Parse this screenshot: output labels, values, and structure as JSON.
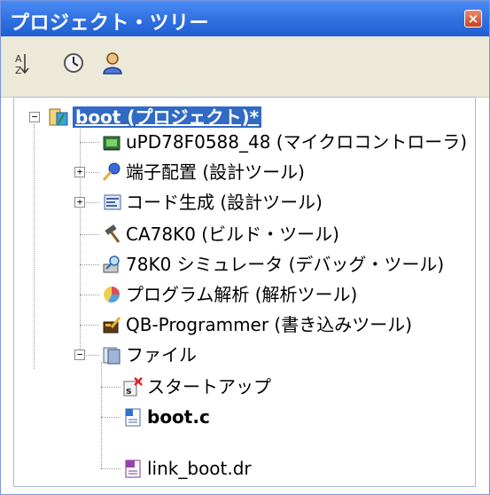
{
  "panel": {
    "title": "プロジェクト・ツリー",
    "close_label": "×"
  },
  "toolbar": {
    "sort_icon_text": "A Z"
  },
  "tree": {
    "root": {
      "label": "boot (プロジェクト)*",
      "expanded_glyph": "−"
    },
    "items": [
      {
        "label": "uPD78F0588_48 (マイクロコントローラ)"
      },
      {
        "label": "端子配置 (設計ツール)",
        "toggle": "+"
      },
      {
        "label": "コード生成 (設計ツール)",
        "toggle": "+"
      },
      {
        "label": "CA78K0 (ビルド・ツール)"
      },
      {
        "label": "78K0 シミュレータ (デバッグ・ツール)"
      },
      {
        "label": "プログラム解析 (解析ツール)"
      },
      {
        "label": "QB-Programmer (書き込みツール)"
      },
      {
        "label": "ファイル",
        "toggle": "−"
      }
    ],
    "files": [
      {
        "label": "スタートアップ"
      },
      {
        "label": "boot.c"
      },
      {
        "label": "link_boot.dr"
      }
    ]
  }
}
